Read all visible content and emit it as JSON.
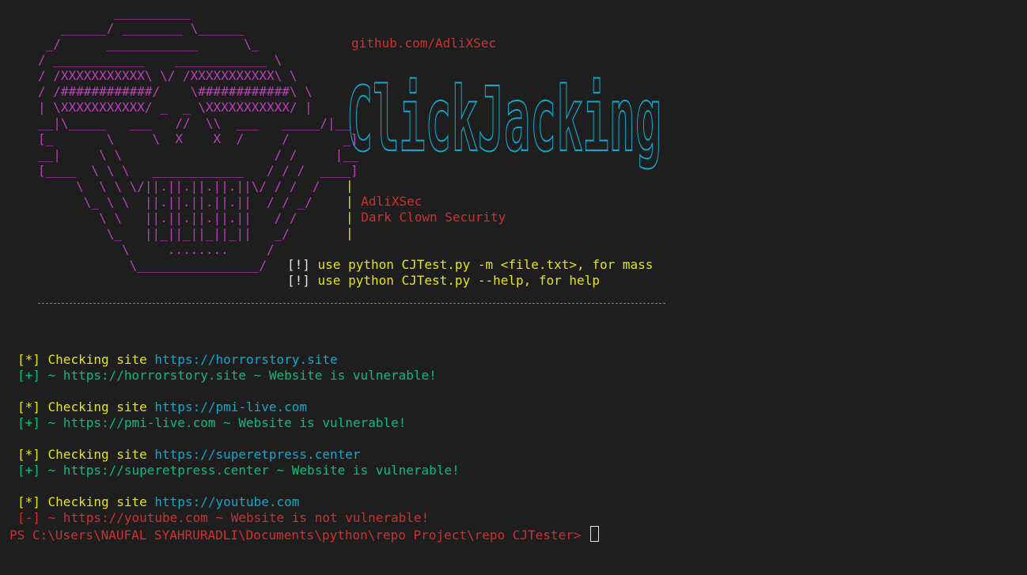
{
  "banner": {
    "skull_lines": [
      "          __________",
      "   ______/ ________ \\______",
      " _/      ____________      \\_",
      "/ ____________    ____________ \\",
      "/ /XXXXXXXXXXX\\ \\/ /XXXXXXXXXXX\\ \\",
      "/ /############/    \\############\\ \\",
      "| \\XXXXXXXXXXX/ _  _ \\XXXXXXXXXXX/ |",
      "__|\\_____   ___   //  \\\\  ___   _____/|__",
      "[_       \\     \\  X    X  /     /       _]",
      "__|     \\ \\                    / /     |__",
      "[____  \\ \\ \\   ____________   / / /  ____]",
      "     \\  \\ \\ \\/||.||.||.||.||\\/ / /  /",
      "      \\_ \\ \\  ||.||.||.||.||  / / _/",
      "        \\ \\   ||.||.||.||.||   / /",
      "         \\_   ||_||_||_||_||   _/",
      "           \\     ........     /",
      "            \\________________/"
    ],
    "github": "github.com/AdliXSec",
    "logo_text": "ClickJacking",
    "author": "AdliXSec",
    "org": "Dark Clown Security",
    "usage": [
      {
        "prefix": "[!]",
        "text": " use python CJTest.py -m <file.txt>, for mass"
      },
      {
        "prefix": "[!]",
        "text": " use python CJTest.py --help, for help"
      }
    ]
  },
  "results": [
    {
      "check_prefix": "[*]",
      "check_label": " Checking site ",
      "url": "https://horrorstory.site",
      "result_prefix": "[+]",
      "result_text": " ~ https://horrorstory.site ~ Website is vulnerable!",
      "vulnerable": true
    },
    {
      "check_prefix": "[*]",
      "check_label": " Checking site ",
      "url": "https://pmi-live.com",
      "result_prefix": "[+]",
      "result_text": " ~ https://pmi-live.com ~ Website is vulnerable!",
      "vulnerable": true
    },
    {
      "check_prefix": "[*]",
      "check_label": " Checking site ",
      "url": "https://superetpress.center",
      "result_prefix": "[+]",
      "result_text": " ~ https://superetpress.center ~ Website is vulnerable!",
      "vulnerable": true
    },
    {
      "check_prefix": "[*]",
      "check_label": " Checking site ",
      "url": "https://youtube.com",
      "result_prefix": "[-]",
      "result_text": " ~ https://youtube.com ~ Website is not vulnerable!",
      "vulnerable": false
    }
  ],
  "prompt": "PS C:\\Users\\NAUFAL SYAHRURADLI\\Documents\\python\\repo Project\\repo CJTester> ",
  "colors": {
    "background": "#1e1e1e",
    "magenta": "#bc3fbc",
    "yellow": "#e5e510",
    "red": "#cd3131",
    "cyan": "#11a8cd",
    "green": "#0dbc79"
  }
}
